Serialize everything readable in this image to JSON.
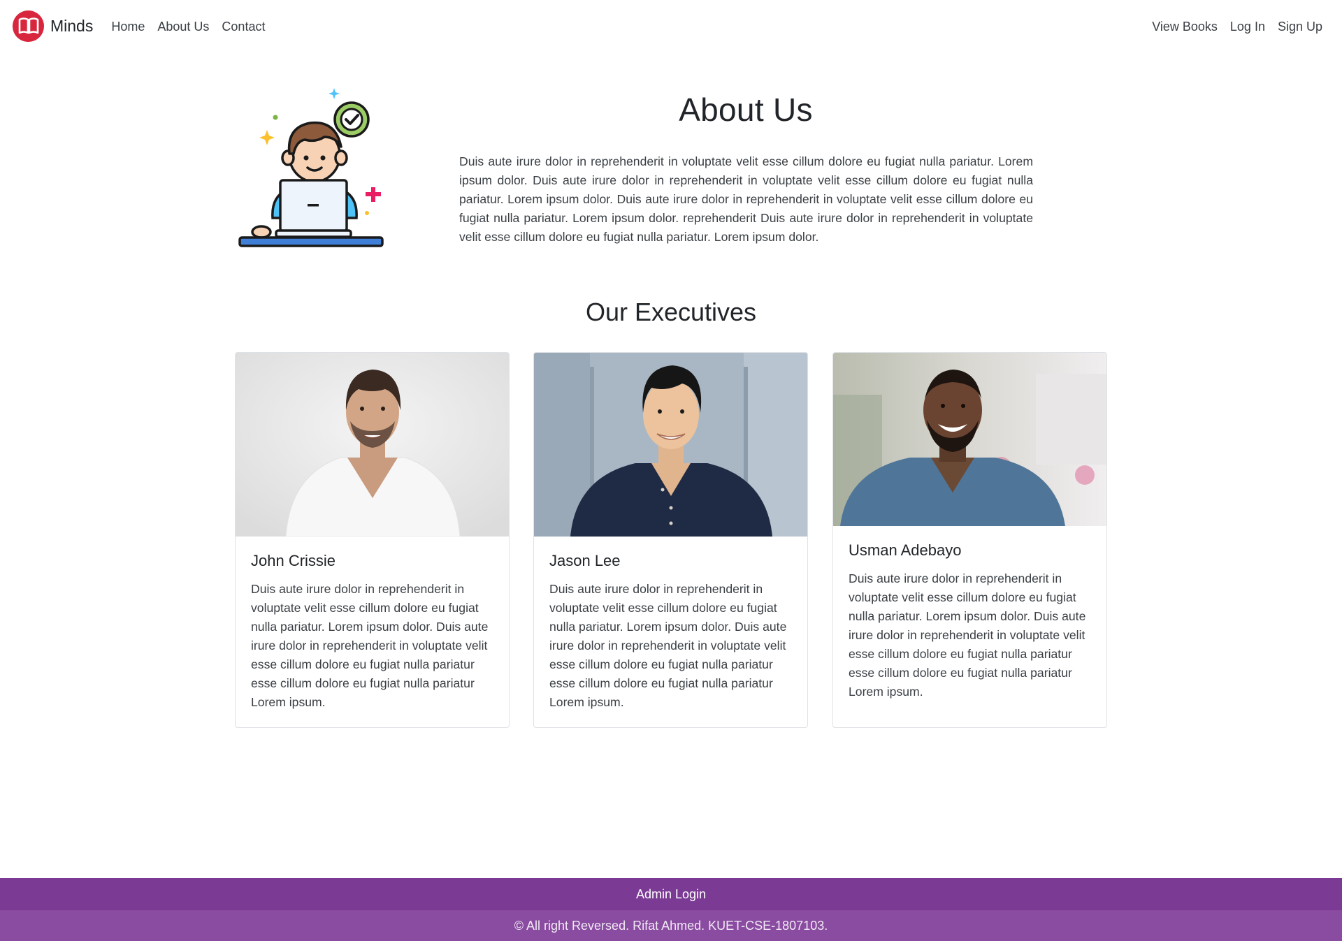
{
  "navbar": {
    "brand": "Minds",
    "left_links": [
      "Home",
      "About Us",
      "Contact"
    ],
    "right_links": [
      "View Books",
      "Log In",
      "Sign Up"
    ]
  },
  "about": {
    "title": "About Us",
    "text": "Duis aute irure dolor in reprehenderit in voluptate velit esse cillum dolore eu fugiat nulla pariatur. Lorem ipsum dolor. Duis aute irure dolor in reprehenderit in voluptate velit esse cillum dolore eu fugiat nulla pariatur. Lorem ipsum dolor. Duis aute irure dolor in reprehenderit in voluptate velit esse cillum dolore eu fugiat nulla pariatur. Lorem ipsum dolor. reprehenderit Duis aute irure dolor in reprehenderit in voluptate velit esse cillum dolore eu fugiat nulla pariatur. Lorem ipsum dolor."
  },
  "executives": {
    "title": "Our Executives",
    "members": [
      {
        "name": "John Crissie",
        "bio": "Duis aute irure dolor in reprehenderit in voluptate velit esse cillum dolore eu fugiat nulla pariatur. Lorem ipsum dolor. Duis aute irure dolor in reprehenderit in voluptate velit esse cillum dolore eu fugiat nulla pariatur esse cillum dolore eu fugiat nulla pariatur Lorem ipsum."
      },
      {
        "name": "Jason Lee",
        "bio": "Duis aute irure dolor in reprehenderit in voluptate velit esse cillum dolore eu fugiat nulla pariatur. Lorem ipsum dolor. Duis aute irure dolor in reprehenderit in voluptate velit esse cillum dolore eu fugiat nulla pariatur esse cillum dolore eu fugiat nulla pariatur Lorem ipsum."
      },
      {
        "name": "Usman Adebayo",
        "bio": "Duis aute irure dolor in reprehenderit in voluptate velit esse cillum dolore eu fugiat nulla pariatur. Lorem ipsum dolor. Duis aute irure dolor in reprehenderit in voluptate velit esse cillum dolore eu fugiat nulla pariatur esse cillum dolore eu fugiat nulla pariatur Lorem ipsum."
      }
    ]
  },
  "footer": {
    "admin_link": "Admin Login",
    "copyright": "© All right Reversed. Rifat Ahmed. KUET-CSE-1807103."
  },
  "icons": {
    "brand": "open-book-icon",
    "illustration": "person-laptop-check-illustration"
  },
  "colors": {
    "brand_red": "#d7263d",
    "footer_top": "#7b3a94",
    "footer_bottom": "#8a4ca0",
    "text_dark": "#212529"
  }
}
